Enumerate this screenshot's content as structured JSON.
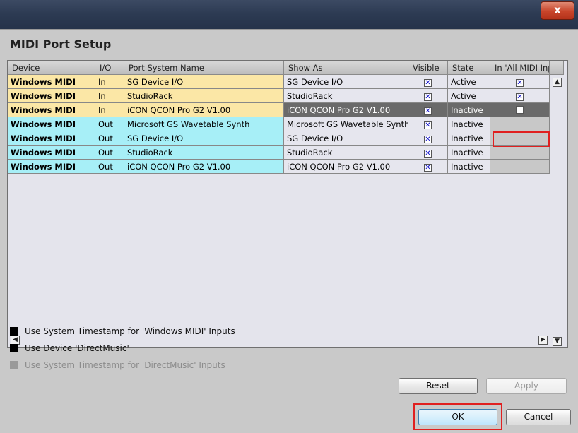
{
  "title_bar": {
    "close_label": "x"
  },
  "dialog": {
    "heading": "MIDI Port Setup"
  },
  "table": {
    "columns": [
      "Device",
      "I/O",
      "Port System Name",
      "Show As",
      "Visible",
      "State",
      "In 'All MIDI Inputs'"
    ],
    "rows": [
      {
        "device": "Windows MIDI",
        "io": "In",
        "port": "SG Device I/O",
        "show_as": "SG Device I/O",
        "visible": "✕",
        "state": "Active",
        "all_midi": "✕"
      },
      {
        "device": "Windows MIDI",
        "io": "In",
        "port": "StudioRack",
        "show_as": "StudioRack",
        "visible": "✕",
        "state": "Active",
        "all_midi": "✕"
      },
      {
        "device": "Windows MIDI",
        "io": "In",
        "port": "iCON QCON Pro G2 V1.00",
        "show_as": "iCON QCON Pro G2 V1.00",
        "visible": "✕",
        "state": "Inactive",
        "all_midi": ""
      },
      {
        "device": "Windows MIDI",
        "io": "Out",
        "port": "Microsoft GS Wavetable Synth",
        "show_as": "Microsoft GS Wavetable Synth",
        "visible": "✕",
        "state": "Inactive",
        "all_midi": ""
      },
      {
        "device": "Windows MIDI",
        "io": "Out",
        "port": "SG Device I/O",
        "show_as": "SG Device I/O",
        "visible": "✕",
        "state": "Inactive",
        "all_midi": ""
      },
      {
        "device": "Windows MIDI",
        "io": "Out",
        "port": "StudioRack",
        "show_as": "StudioRack",
        "visible": "✕",
        "state": "Inactive",
        "all_midi": ""
      },
      {
        "device": "Windows MIDI",
        "io": "Out",
        "port": "iCON QCON Pro G2 V1.00",
        "show_as": "iCON QCON Pro G2 V1.00",
        "visible": "✕",
        "state": "Inactive",
        "all_midi": ""
      }
    ]
  },
  "scroll": {
    "up": "▲",
    "down": "▼",
    "left": "◀",
    "right": "▶"
  },
  "options": [
    {
      "label": "Use System Timestamp for 'Windows MIDI' Inputs",
      "enabled": true
    },
    {
      "label": "Use Device 'DirectMusic'",
      "enabled": true
    },
    {
      "label": "Use System Timestamp for 'DirectMusic' Inputs",
      "enabled": false
    }
  ],
  "buttons": {
    "reset": "Reset",
    "apply": "Apply",
    "ok": "OK",
    "cancel": "Cancel"
  },
  "colors": {
    "input_row": "#fbe7a6",
    "output_row": "#a7eff7",
    "highlight": "#e02020",
    "checkmark": "#1010c8"
  }
}
